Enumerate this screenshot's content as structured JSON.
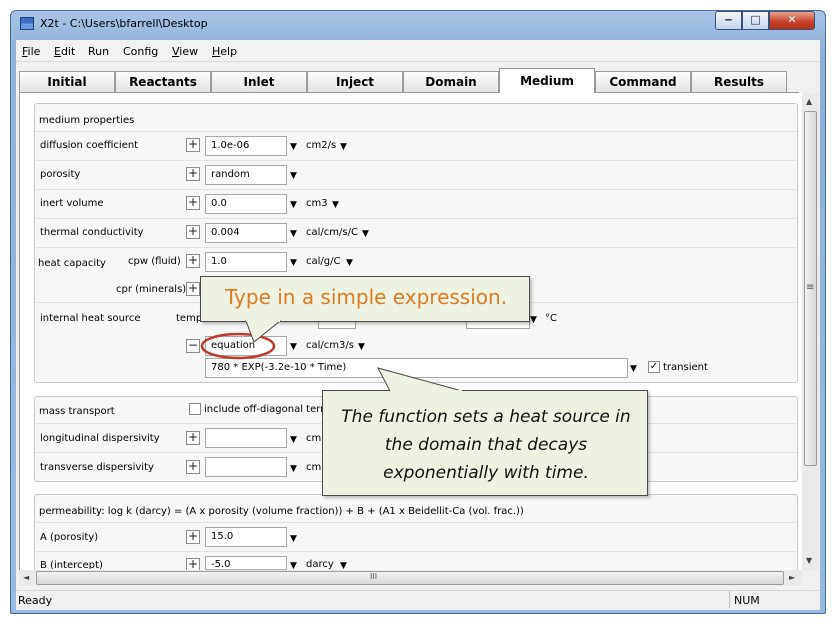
{
  "window": {
    "title": "X2t - C:\\Users\\bfarrell\\Desktop",
    "minimize": "‒",
    "maximize": "□",
    "close": "✕"
  },
  "menu": [
    "File",
    "Edit",
    "Run",
    "Config",
    "View",
    "Help"
  ],
  "tabs": [
    "Initial",
    "Reactants",
    "Inlet",
    "Inject",
    "Domain",
    "Medium",
    "Command",
    "Results"
  ],
  "active_tab": "Medium",
  "medium": {
    "title": "medium properties",
    "diffusion": {
      "label": "diffusion coefficient",
      "value": "1.0e-06",
      "unit": "cm2/s"
    },
    "porosity": {
      "label": "porosity",
      "value": "random"
    },
    "inert": {
      "label": "inert volume",
      "value": "0.0",
      "unit": "cm3"
    },
    "thermal": {
      "label": "thermal conductivity",
      "value": "0.004",
      "unit": "cal/cm/s/C"
    },
    "heat_capacity": {
      "label": "heat capacity",
      "cpw_label": "cpw (fluid)",
      "cpw_value": "1.0",
      "cpw_unit": "cal/g/C",
      "cpr_label": "cpr (minerals)"
    },
    "heat_source": {
      "label": "internal heat source",
      "temp_label": "temp",
      "temp_unit": "°C",
      "type_value": "equation",
      "type_unit": "cal/cm3/s",
      "expression": "780 * EXP(-3.2e-10 * Time)",
      "transient_label": "transient",
      "transient_checked": true
    }
  },
  "mass_transport": {
    "title": "mass transport",
    "offdiag_label": "include off-diagonal term",
    "longitudinal": {
      "label": "longitudinal dispersivity",
      "value": "",
      "unit": "cm"
    },
    "transverse": {
      "label": "transverse dispersivity",
      "value": "",
      "unit": "cm"
    }
  },
  "permeability": {
    "title": "permeability: log k (darcy) = (A x porosity (volume fraction)) + B + (A1 x Beidellit-Ca (vol. frac.))",
    "a": {
      "label": "A (porosity)",
      "value": "15.0"
    },
    "b": {
      "label": "B (intercept)",
      "value": "-5.0",
      "unit": "darcy"
    }
  },
  "callouts": {
    "top": "Type in a simple expression.",
    "bottom": "The function sets a heat source in the domain that decays exponentially with time."
  },
  "icons": {
    "dropdown": "▼",
    "expand": "+",
    "collapse": "−",
    "check": "✓",
    "scroll_up": "▲",
    "scroll_down": "▼",
    "scroll_left": "◄",
    "scroll_right": "►",
    "grip": "≡",
    "hgrip": "III"
  },
  "status": {
    "text": "Ready",
    "num": "NUM"
  }
}
